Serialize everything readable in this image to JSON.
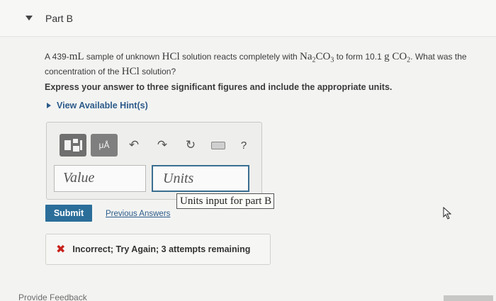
{
  "part": {
    "title": "Part B"
  },
  "question": {
    "pre_volume": "A 439-",
    "volume_unit": "mL",
    "mid1": " sample of unknown ",
    "acid": "HCl",
    "mid2": " solution reacts completely with ",
    "salt_a": "Na",
    "salt_sub1": "2",
    "salt_b": "CO",
    "salt_sub2": "3",
    "mid3": " to form 10.1 ",
    "mass_unit": "g",
    "gas_a": " CO",
    "gas_sub": "2",
    "mid4": ". What was the concentration of the ",
    "acid2": "HCl",
    "end": " solution?"
  },
  "instruction": "Express your answer to three significant figures and include the appropriate units.",
  "hints": {
    "label": "View Available Hint(s)"
  },
  "toolbar": {
    "templates_icon": "templates-icon",
    "mu_label": "μÅ",
    "undo_icon": "undo-icon",
    "redo_icon": "redo-icon",
    "reset_icon": "reset-icon",
    "keyboard_icon": "keyboard-icon",
    "help_label": "?"
  },
  "inputs": {
    "value_placeholder": "Value",
    "units_placeholder": "Units",
    "units_tooltip": "Units input for part B"
  },
  "actions": {
    "submit_label": "Submit",
    "previous_answers_label": "Previous Answers"
  },
  "feedback": {
    "message": "Incorrect; Try Again; 3 attempts remaining"
  },
  "footer": {
    "provide_feedback": "Provide Feedback"
  },
  "colors": {
    "accent": "#2b6e9a",
    "error": "#c8221c",
    "link": "#2c5a8a"
  }
}
